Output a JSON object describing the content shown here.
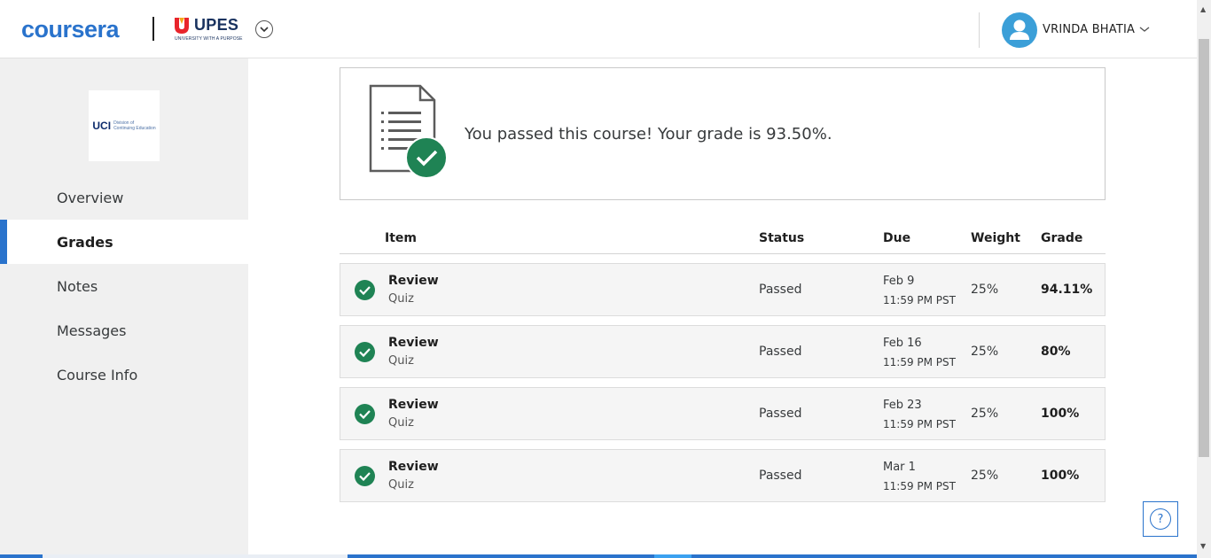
{
  "header": {
    "brand": "coursera",
    "partner": {
      "name": "UPES",
      "tagline": "UNIVERSITY WITH A PURPOSE"
    },
    "user_name": "VRINDA BHATIA"
  },
  "sidebar": {
    "partner_logo": {
      "abbr": "UCI",
      "line1": "Division of",
      "line2": "Continuing Education"
    },
    "items": [
      {
        "label": "Overview",
        "active": false
      },
      {
        "label": "Grades",
        "active": true
      },
      {
        "label": "Notes",
        "active": false
      },
      {
        "label": "Messages",
        "active": false
      },
      {
        "label": "Course Info",
        "active": false
      }
    ]
  },
  "banner": {
    "message": "You passed this course! Your grade is 93.50%."
  },
  "table": {
    "headers": {
      "item": "Item",
      "status": "Status",
      "due": "Due",
      "weight": "Weight",
      "grade": "Grade"
    },
    "rows": [
      {
        "title": "Review",
        "type": "Quiz",
        "status": "Passed",
        "due_date": "Feb 9",
        "due_time": "11:59 PM PST",
        "weight": "25%",
        "grade": "94.11%"
      },
      {
        "title": "Review",
        "type": "Quiz",
        "status": "Passed",
        "due_date": "Feb 16",
        "due_time": "11:59 PM PST",
        "weight": "25%",
        "grade": "80%"
      },
      {
        "title": "Review",
        "type": "Quiz",
        "status": "Passed",
        "due_date": "Feb 23",
        "due_time": "11:59 PM PST",
        "weight": "25%",
        "grade": "100%"
      },
      {
        "title": "Review",
        "type": "Quiz",
        "status": "Passed",
        "due_date": "Mar 1",
        "due_time": "11:59 PM PST",
        "weight": "25%",
        "grade": "100%"
      }
    ]
  },
  "help": {
    "symbol": "?"
  },
  "colors": {
    "brand_blue": "#2a73cc",
    "success_green": "#1f8354",
    "sidebar_bg": "#f0f0f0"
  },
  "icons": [
    "user-avatar-icon",
    "chevron-down-icon",
    "document-check-icon",
    "check-circle-icon",
    "help-icon"
  ]
}
